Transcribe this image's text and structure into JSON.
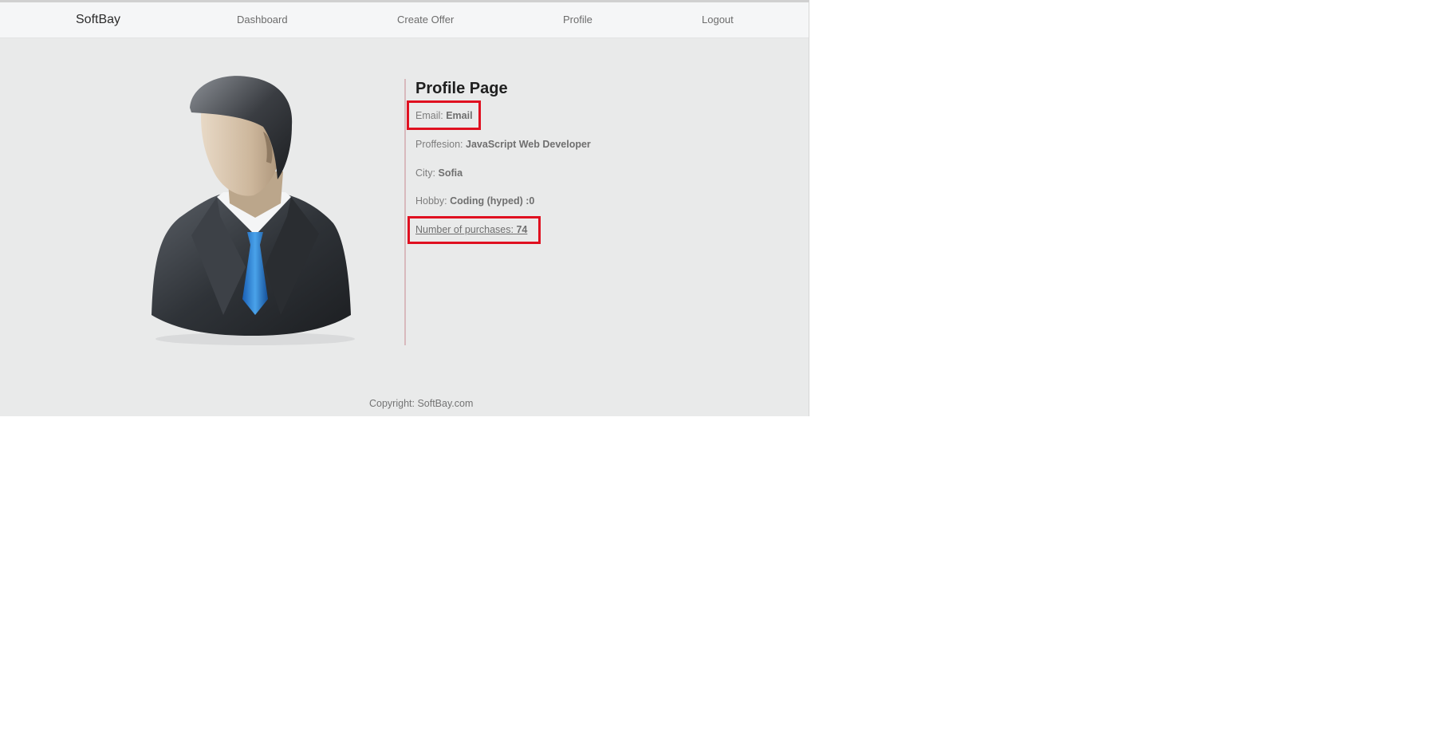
{
  "nav": {
    "brand": "SoftBay",
    "dashboard": "Dashboard",
    "create_offer": "Create Offer",
    "profile": "Profile",
    "logout": "Logout"
  },
  "profile": {
    "title": "Profile Page",
    "email_label": "Email:",
    "email_value": "Email",
    "profession_label": "Proffesion:",
    "profession_value": "JavaScript Web Developer",
    "city_label": "City:",
    "city_value": "Sofia",
    "hobby_label": "Hobby:",
    "hobby_value": "Coding (hyped) :0",
    "purchases_label": "Number of purchases:",
    "purchases_value": "74"
  },
  "footer": {
    "copyright": "Copyright: SoftBay.com"
  },
  "colors": {
    "highlight": "#e01020",
    "page_bg": "#e9eaea",
    "navbar_bg": "#f5f6f7"
  }
}
